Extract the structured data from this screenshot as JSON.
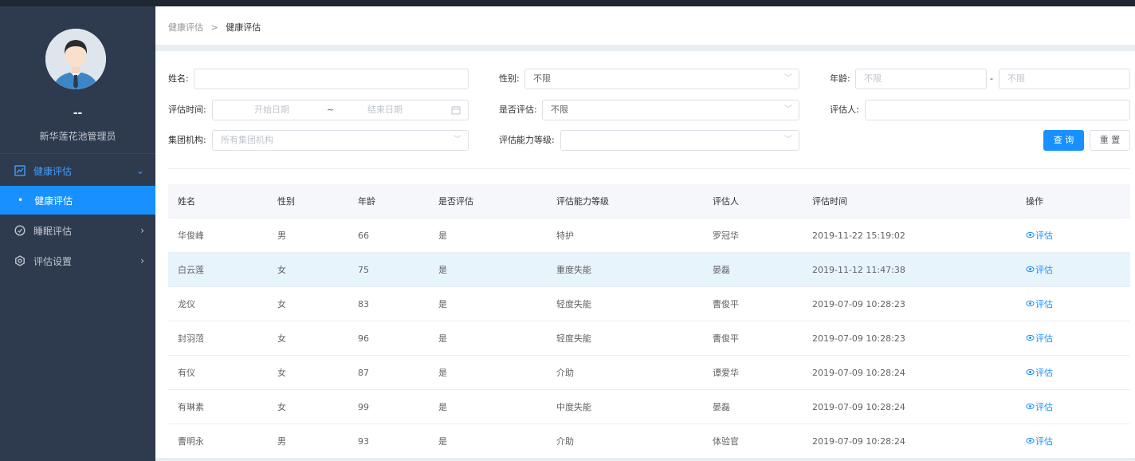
{
  "breadcrumb": {
    "root": "健康评估",
    "sep": ">",
    "current": "健康评估"
  },
  "user": {
    "name": "--",
    "role": "新华莲花池管理员"
  },
  "sidebar": {
    "items": [
      {
        "label": "健康评估",
        "icon": "chart-icon",
        "arrow": "⌄"
      },
      {
        "label": "健康评估",
        "bullet": "•"
      },
      {
        "label": "睡眠评估",
        "icon": "clock-icon",
        "arrow": "›"
      },
      {
        "label": "评估设置",
        "icon": "settings-icon",
        "arrow": "›"
      }
    ]
  },
  "filters": {
    "name_label": "姓名:",
    "name_value": "",
    "gender_label": "性别:",
    "gender_value": "不限",
    "age_label": "年龄:",
    "age_min_placeholder": "不限",
    "age_sep": "-",
    "age_max_placeholder": "不限",
    "time_label": "评估时间:",
    "time_start_placeholder": "开始日期",
    "time_sep": "~",
    "time_end_placeholder": "结束日期",
    "assessed_label": "是否评估:",
    "assessed_value": "不限",
    "assessor_label": "评估人:",
    "assessor_value": "",
    "org_label": "集团机构:",
    "org_placeholder": "所有集团机构",
    "level_label": "评估能力等级:",
    "level_value": "",
    "query_button": "查 询",
    "reset_button": "重 置"
  },
  "table": {
    "columns": [
      "姓名",
      "性别",
      "年龄",
      "是否评估",
      "评估能力等级",
      "评估人",
      "评估时间",
      "操作"
    ],
    "action_label": "评估",
    "rows": [
      [
        "华俊峰",
        "男",
        "66",
        "是",
        "特护",
        "罗冠华",
        "2019-11-22 15:19:02"
      ],
      [
        "白云莲",
        "女",
        "75",
        "是",
        "重度失能",
        "晏磊",
        "2019-11-12 11:47:38"
      ],
      [
        "龙仪",
        "女",
        "83",
        "是",
        "轻度失能",
        "曹俊平",
        "2019-07-09 10:28:23"
      ],
      [
        "封羽菬",
        "女",
        "96",
        "是",
        "轻度失能",
        "曹俊平",
        "2019-07-09 10:28:23"
      ],
      [
        "有仪",
        "女",
        "87",
        "是",
        "介助",
        "谭爱华",
        "2019-07-09 10:28:24"
      ],
      [
        "有琳素",
        "女",
        "99",
        "是",
        "中度失能",
        "晏磊",
        "2019-07-09 10:28:24"
      ],
      [
        "曹明永",
        "男",
        "93",
        "是",
        "介助",
        "体验官",
        "2019-07-09 10:28:24"
      ]
    ]
  },
  "colors": {
    "primary": "#1890ff",
    "sidebar_bg": "#2e3a4e",
    "row_highlight": "#e8f4fb"
  }
}
